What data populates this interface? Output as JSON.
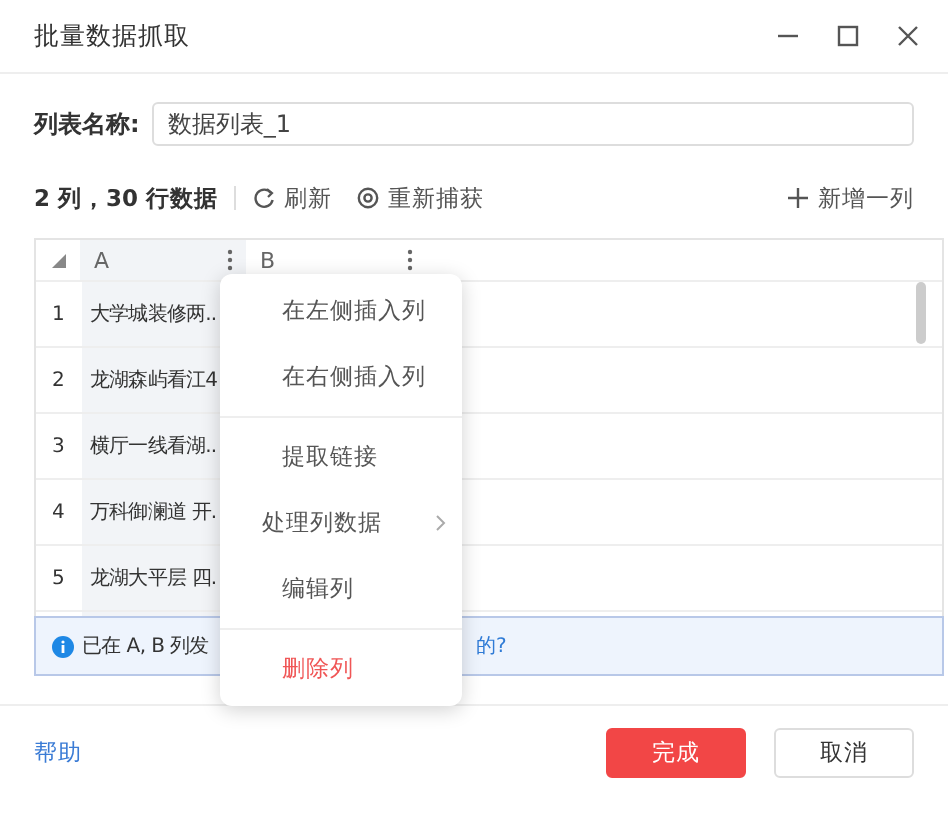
{
  "window": {
    "title": "批量数据抓取"
  },
  "list_name": {
    "label": "列表名称:",
    "value": "数据列表_1"
  },
  "toolbar": {
    "summary": "2 列，30 行数据",
    "actions": [
      {
        "label": "刷新",
        "kind": "refresh"
      },
      {
        "label": "重新捕获",
        "kind": "recapture"
      }
    ],
    "add": "新增一列"
  },
  "table": {
    "columns": [
      {
        "label": "A",
        "selected": true
      },
      {
        "label": "B",
        "selected": false
      }
    ],
    "rows": [
      {
        "index": "1",
        "a": "大学城装修两.."
      },
      {
        "index": "2",
        "a": "龙湖森屿看江4"
      },
      {
        "index": "3",
        "a": "横厅一线看湖.."
      },
      {
        "index": "4",
        "a": "万科御澜道 开."
      },
      {
        "index": "5",
        "a": "龙湖大平层 四."
      }
    ]
  },
  "info": {
    "text": "已在 A, B 列发",
    "link": "的?"
  },
  "context_menu": {
    "items": [
      {
        "label": "在左侧插入列",
        "kind": "action"
      },
      {
        "label": "在右侧插入列",
        "kind": "action"
      },
      {
        "kind": "divider"
      },
      {
        "label": "提取链接",
        "kind": "action"
      },
      {
        "label": "处理列数据",
        "kind": "submenu"
      },
      {
        "label": "编辑列",
        "kind": "action"
      },
      {
        "kind": "divider"
      },
      {
        "label": "删除列",
        "kind": "danger"
      }
    ]
  },
  "footer": {
    "help": "帮助",
    "buttons": [
      {
        "label": "完成",
        "kind": "primary"
      },
      {
        "label": "取消",
        "kind": "default"
      }
    ]
  }
}
